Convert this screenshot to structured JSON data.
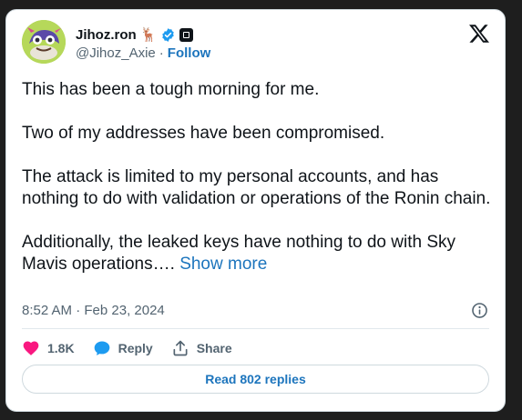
{
  "author": {
    "display_name": "Jihoz.ron",
    "name_emoji": "🦌",
    "handle": "@Jihoz_Axie",
    "separator": "·",
    "follow_label": "Follow"
  },
  "tweet": {
    "paragraphs": [
      "This has been a tough morning for me.",
      "Two of my addresses have been compromised.",
      "The attack is limited to my personal accounts, and has nothing to do with validation or operations of the Ronin chain.",
      "Additionally, the leaked keys have nothing to do with Sky Mavis operations…."
    ],
    "show_more_label": "Show more",
    "timestamp": "8:52 AM · Feb 23, 2024"
  },
  "actions": {
    "likes_count": "1.8K",
    "reply_label": "Reply",
    "share_label": "Share"
  },
  "read_replies_label": "Read 802 replies",
  "icons": {
    "verified": "verified-badge-icon",
    "affiliation": "affiliation-badge-icon",
    "brand": "x-logo-icon",
    "info": "info-icon",
    "like": "heart-icon",
    "reply": "speech-bubble-icon",
    "share": "share-upload-icon"
  },
  "colors": {
    "link": "#1d75bd",
    "like": "#f91880",
    "verified": "#1d9bf0",
    "text": "#0f1419",
    "secondary": "#536471"
  }
}
